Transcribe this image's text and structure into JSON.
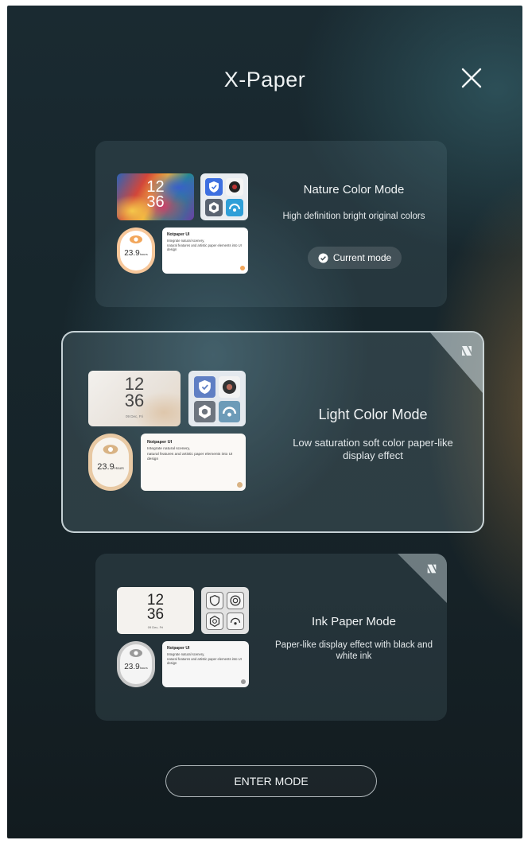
{
  "header": {
    "title": "X-Paper",
    "close_icon": "close-icon"
  },
  "modes": [
    {
      "title": "Nature Color Mode",
      "description": "High definition bright original colors",
      "current_label": "Current mode",
      "preview": {
        "clock_hour": "12",
        "clock_minute": "36",
        "ring_value": "23.9",
        "ring_unit": "hours",
        "note_title": "Notpaper UI",
        "note_line1": "Integrate natural scenery,",
        "note_line2": "natural features and artistic paper elements into UI design"
      }
    },
    {
      "title": "Light Color Mode",
      "description": "Low saturation soft color paper-like display effect",
      "preview": {
        "clock_hour": "12",
        "clock_minute": "36",
        "clock_date": "09 Dec, Fri",
        "ring_value": "23.9",
        "ring_unit": "Hours",
        "note_title": "Notpaper UI",
        "note_line1": "Integrate natural scenery,",
        "note_line2": "natural features and artistic paper elements into UI design"
      }
    },
    {
      "title": "Ink Paper Mode",
      "description": "Paper-like display effect with black and white ink",
      "preview": {
        "clock_hour": "12",
        "clock_minute": "36",
        "clock_date": "09 Dec, Fri",
        "ring_value": "23.9",
        "ring_unit": "hours",
        "note_title": "Notpaper UI",
        "note_line1": "Integrate natural scenery,",
        "note_line2": "natural features and artistic paper elements into UI design"
      }
    }
  ],
  "footer": {
    "enter_label": "ENTER MODE"
  },
  "colors": {
    "background": "#17262c",
    "accent_light": "#e7d2b6",
    "accent_blue": "#3b82f6"
  }
}
